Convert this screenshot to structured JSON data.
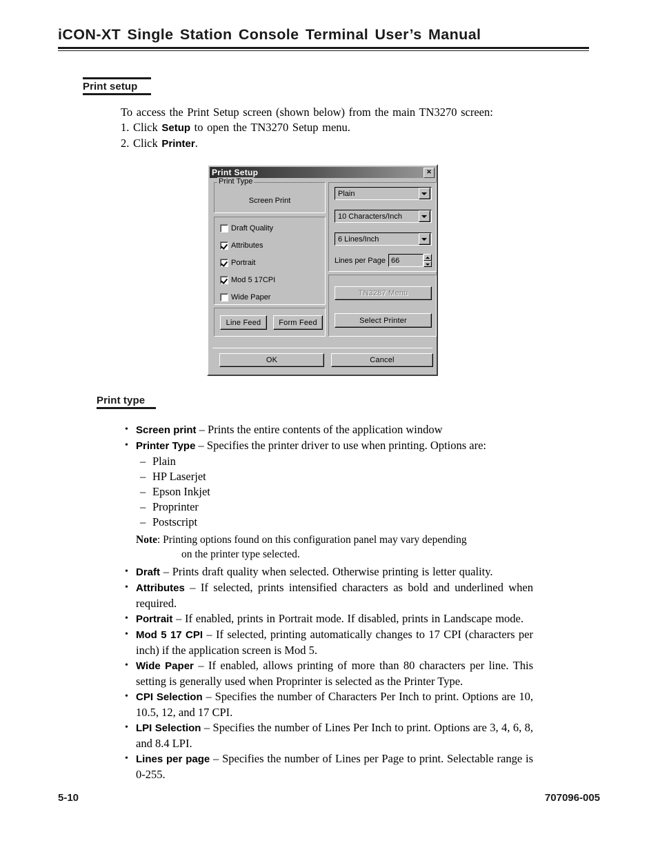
{
  "header": {
    "title": "iCON-XT Single Station Console Terminal User’s Manual"
  },
  "print_setup_section": {
    "heading": "Print setup",
    "intro": "To access the Print Setup screen (shown below) from the main TN3270 screen:",
    "steps": [
      {
        "num": "1.",
        "pre": "Click ",
        "bold": "Setup",
        "post": " to open the TN3270 Setup menu."
      },
      {
        "num": "2.",
        "pre": "Click ",
        "bold": "Printer",
        "post": "."
      }
    ]
  },
  "dialog": {
    "title": "Print Setup",
    "close_label": "✕",
    "print_type_group": {
      "legend": "Print Type",
      "value": "Screen Print"
    },
    "checkboxes": [
      {
        "label": "Draft Quality",
        "checked": false
      },
      {
        "label": "Attributes",
        "checked": true
      },
      {
        "label": "Portrait",
        "checked": true
      },
      {
        "label": "Mod 5 17CPI",
        "checked": true
      },
      {
        "label": "Wide Paper",
        "checked": false
      }
    ],
    "feed_buttons": {
      "line_feed": "Line Feed",
      "form_feed": "Form Feed"
    },
    "combos": {
      "printer_type": "Plain",
      "cpi": "10 Characters/Inch",
      "lpi": "6 Lines/Inch"
    },
    "lines_per_page": {
      "label": "Lines per Page",
      "value": "66"
    },
    "printer_buttons": {
      "tn3287_menu": "TN3287 Menu",
      "select_printer": "Select Printer"
    },
    "footer_buttons": {
      "ok": "OK",
      "cancel": "Cancel"
    },
    "colors": {
      "face": "#c0c0c0",
      "titlebar_dark": "#2b2b2b",
      "titlebar_light": "#9a9a9a",
      "disabled_text": "#808080"
    }
  },
  "print_type_section": {
    "heading": "Print type",
    "bullets": [
      {
        "term": "Screen print",
        "text": " – Prints the entire contents of the application window"
      },
      {
        "term": "Printer Type",
        "text": " – Specifies the printer driver to use when printing. Options are:"
      }
    ],
    "printer_options": [
      "Plain",
      "HP Laserjet",
      "Epson Inkjet",
      "Proprinter",
      "Postscript"
    ],
    "note": {
      "word": "Note",
      "line1": ":  Printing options found on this configuration panel may vary depending",
      "line2": "on the printer type selected."
    },
    "bullets2": [
      {
        "term": "Draft",
        "text": " – Prints draft quality when selected. Otherwise printing is letter quality."
      },
      {
        "term": "Attributes",
        "text": " – If selected, prints intensified characters as bold and underlined when required."
      },
      {
        "term": "Portrait",
        "text": " – If enabled, prints in Portrait mode. If disabled, prints in Landscape mode."
      },
      {
        "term": "Mod 5 17 CPI",
        "text": " – If selected, printing automatically changes to 17 CPI (characters per inch) if the application screen is Mod 5."
      },
      {
        "term": "Wide Paper",
        "text": " – If enabled, allows printing of more than 80 characters per line. This setting is generally used when Proprinter is selected as the Printer Type."
      },
      {
        "term": "CPI Selection",
        "text": " – Specifies the number of Characters Per Inch to print. Options are 10, 10.5, 12, and 17 CPI."
      },
      {
        "term": "LPI Selection",
        "text": " – Specifies the number of Lines Per Inch to print. Options are 3, 4, 6, 8, and 8.4 LPI."
      },
      {
        "term": "Lines per page",
        "text": " – Specifies the number of Lines per Page to print. Selectable range is 0-255."
      }
    ]
  },
  "footer": {
    "page_number": "5-10",
    "doc_number": "707096-005"
  }
}
